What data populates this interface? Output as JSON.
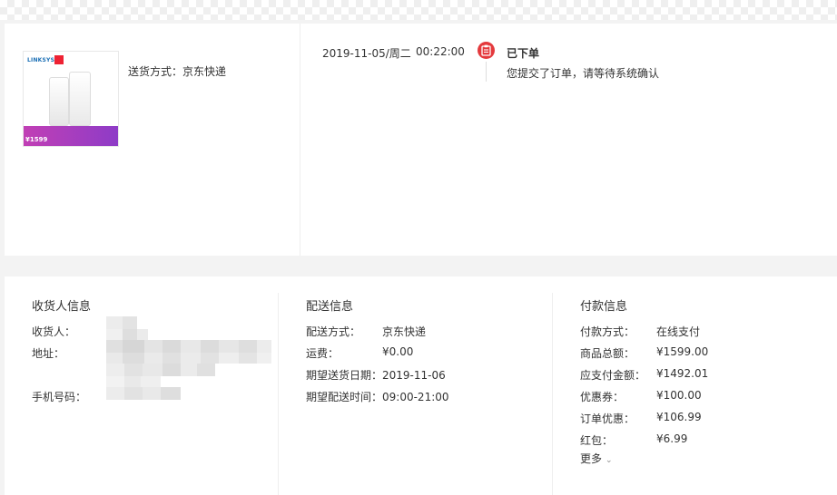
{
  "order": {
    "delivery_text": "送货方式：京东快递",
    "product_image": {
      "brand": "LINKSYS",
      "price_tag": "¥1599"
    },
    "timeline": {
      "date": "2019-11-05/周二",
      "time": "00:22:00",
      "status_title": "已下单",
      "status_desc": "您提交了订单，请等待系统确认"
    }
  },
  "consignee": {
    "title": "收货人信息",
    "name_label": "收货人：",
    "address_label": "地址：",
    "phone_label": "手机号码："
  },
  "shipping": {
    "title": "配送信息",
    "method_label": "配送方式：",
    "method_value": "京东快递",
    "fee_label": "运费：",
    "fee_value": "¥0.00",
    "date_label": "期望送货日期：",
    "date_value": "2019-11-06",
    "time_label": "期望配送时间：",
    "time_value": "09:00-21:00"
  },
  "payment": {
    "title": "付款信息",
    "method_label": "付款方式：",
    "method_value": "在线支付",
    "total_label": "商品总额：",
    "total_value": "¥1599.00",
    "payable_label": "应支付金额：",
    "payable_value": "¥1492.01",
    "coupon_label": "优惠券：",
    "coupon_value": "¥100.00",
    "discount_label": "订单优惠：",
    "discount_value": "¥106.99",
    "redpacket_label": "红包：",
    "redpacket_value": "¥6.99",
    "more_label": "更多"
  },
  "colors": {
    "accent": "#e4393c",
    "background": "#f3f3f3",
    "panel": "#ffffff"
  }
}
